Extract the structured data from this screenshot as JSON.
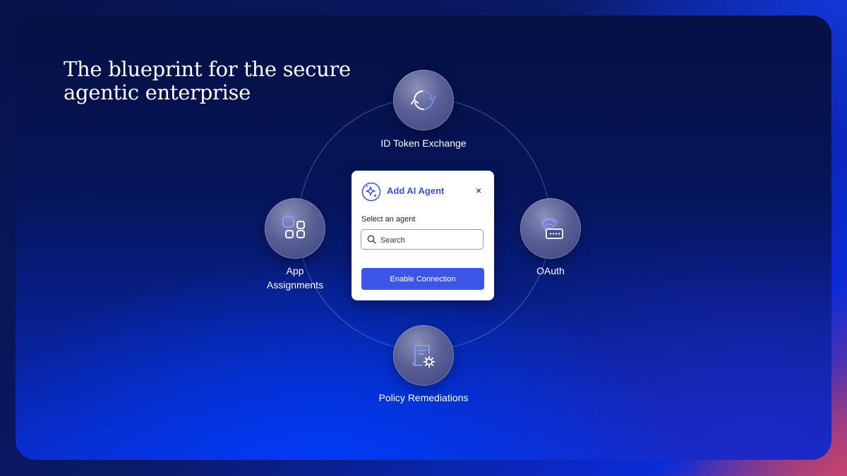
{
  "headline": "The blueprint for the secure agentic enterprise",
  "nodes": {
    "top": {
      "label": "ID Token Exchange",
      "icon": "sync-arrows-icon"
    },
    "left": {
      "label_line1": "App",
      "label_line2": "Assignments",
      "icon": "app-grid-icon"
    },
    "right": {
      "label": "OAuth",
      "icon": "fingerprint-password-icon"
    },
    "bottom": {
      "label": "Policy Remediations",
      "icon": "document-gear-icon"
    }
  },
  "dialog": {
    "title": "Add AI Agent",
    "close_glyph": "×",
    "field_label": "Select an agent",
    "search_placeholder": "Search",
    "button_label": "Enable Connection",
    "icon": "sparkle-icon"
  },
  "colors": {
    "accent": "#3d55e6",
    "title_blue": "#3a4fd8",
    "icon_blue": "#7b8cff"
  }
}
